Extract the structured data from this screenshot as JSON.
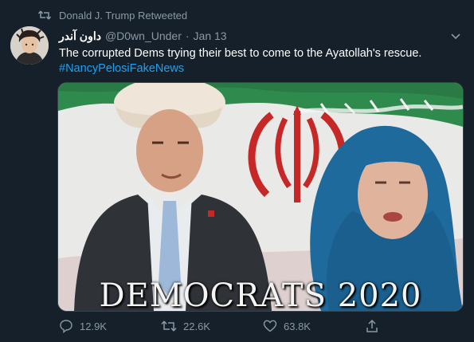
{
  "retweet": {
    "label": "Donald J. Trump Retweeted"
  },
  "tweet": {
    "display_name": "داون آندر",
    "handle": "@D0wn_Under",
    "separator": "·",
    "date": "Jan 13",
    "text": "The corrupted Dems trying their best to come to the Ayatollah's rescue.",
    "hashtag": "#NancyPelosiFakeNews",
    "media_caption": "DEMOCRATS 2020"
  },
  "actions": {
    "replies": "12.9K",
    "retweets": "22.6K",
    "likes": "63.8K"
  },
  "colors": {
    "background": "#15202b",
    "secondary_text": "#8899a6",
    "link": "#1da1f2"
  }
}
